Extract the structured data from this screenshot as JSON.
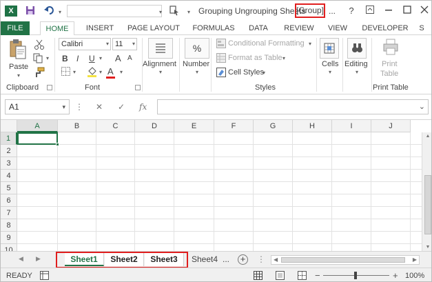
{
  "window": {
    "app_logo": "X",
    "title": "Grouping Ungrouping Sheets",
    "group_tag": "[Group]",
    "title_overflow": "...",
    "help_label": "?",
    "icons": [
      "excel-logo-icon",
      "save-icon",
      "undo-icon",
      "touch-mode-icon",
      "ribbon-display-icon",
      "minimize-icon",
      "maximize-icon"
    ]
  },
  "tabs": [
    "FILE",
    "HOME",
    "INSERT",
    "PAGE LAYOUT",
    "FORMULAS",
    "DATA",
    "REVIEW",
    "VIEW",
    "DEVELOPER",
    "S"
  ],
  "ribbon": {
    "clipboard": {
      "label": "Clipboard",
      "paste": "Paste"
    },
    "font": {
      "label": "Font",
      "name": "Calibri",
      "size": "11",
      "bold": "B",
      "italic": "I",
      "underline": "U",
      "grow": "A",
      "shrink": "A",
      "font_color": "A",
      "font_color_hex": "#e01e1e"
    },
    "alignment": {
      "label": "Alignment"
    },
    "number": {
      "label": "Number",
      "symbol": "%"
    },
    "styles": {
      "label": "Styles",
      "conditional": "Conditional Formatting",
      "format_table": "Format as Table",
      "cell_styles": "Cell Styles"
    },
    "cells": {
      "label": "Cells"
    },
    "editing": {
      "label": "Editing"
    },
    "print_table": {
      "button_line1": "Print",
      "button_line2": "Table",
      "label": "Print Table"
    }
  },
  "formula_bar": {
    "name_box": "A1",
    "fx": "fx",
    "cancel": "✕",
    "enter": "✓",
    "dots": "⋮"
  },
  "grid": {
    "columns": [
      "A",
      "B",
      "C",
      "D",
      "E",
      "F",
      "G",
      "H",
      "I",
      "J"
    ],
    "rows": [
      "1",
      "2",
      "3",
      "4",
      "5",
      "6",
      "7",
      "8",
      "9",
      "10"
    ],
    "active_cell": "A1"
  },
  "sheets": {
    "tabs": [
      "Sheet1",
      "Sheet2",
      "Sheet3",
      "Sheet4"
    ],
    "grouped": [
      "Sheet1",
      "Sheet2",
      "Sheet3"
    ],
    "active": "Sheet1",
    "overflow": "...",
    "add_label": "+"
  },
  "status": {
    "mode": "READY",
    "zoom": "100%",
    "zoom_minus": "−",
    "zoom_plus": "+"
  },
  "colors": {
    "excel_green": "#217346",
    "highlight_red": "#e01e1e"
  }
}
